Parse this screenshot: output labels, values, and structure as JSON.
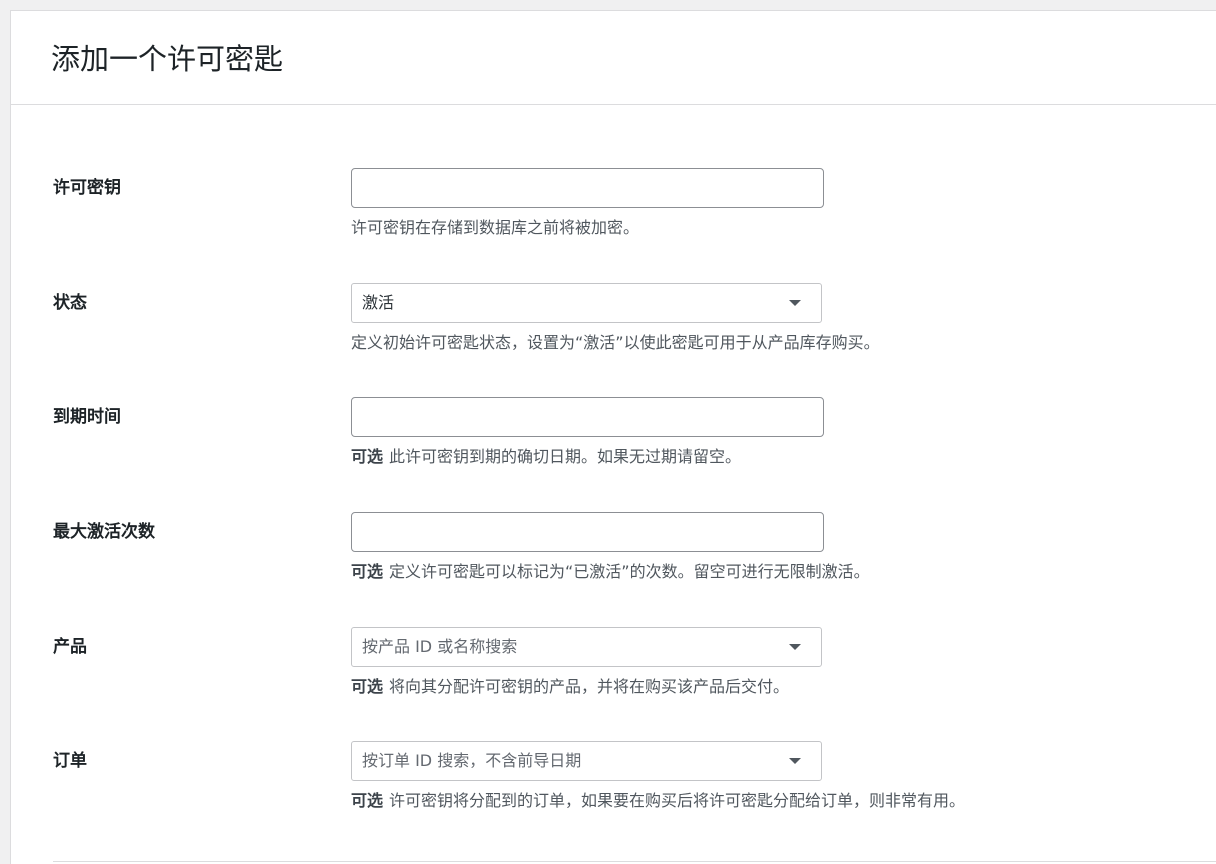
{
  "page": {
    "title": "添加一个许可密匙"
  },
  "form": {
    "license_key": {
      "label": "许可密钥",
      "value": "",
      "description": "许可密钥在存储到数据库之前将被加密。"
    },
    "status": {
      "label": "状态",
      "selected": "激活",
      "description": "定义初始许可密匙状态，设置为“激活”以使此密匙可用于从产品库存购买。"
    },
    "expires_at": {
      "label": "到期时间",
      "value": "",
      "optional_tag": "可选",
      "description": "此许可密钥到期的确切日期。如果无过期请留空。"
    },
    "max_activations": {
      "label": "最大激活次数",
      "value": "",
      "optional_tag": "可选",
      "description": "定义许可密匙可以标记为“已激活”的次数。留空可进行无限制激活。"
    },
    "product": {
      "label": "产品",
      "placeholder": "按产品 ID 或名称搜索",
      "optional_tag": "可选",
      "description": "将向其分配许可密钥的产品，并将在购买该产品后交付。"
    },
    "order": {
      "label": "订单",
      "placeholder": "按订单 ID 搜索，不含前导日期",
      "optional_tag": "可选",
      "description": "许可密钥将分配到的订单，如果要在购买后将许可密匙分配给订单，则非常有用。"
    }
  },
  "icons": {
    "dropdown": "caret-down-icon"
  },
  "colors": {
    "background": "#f0f0f1",
    "panel": "#ffffff",
    "border": "#dcdcde",
    "text": "#1d2327",
    "muted": "#50575e"
  }
}
